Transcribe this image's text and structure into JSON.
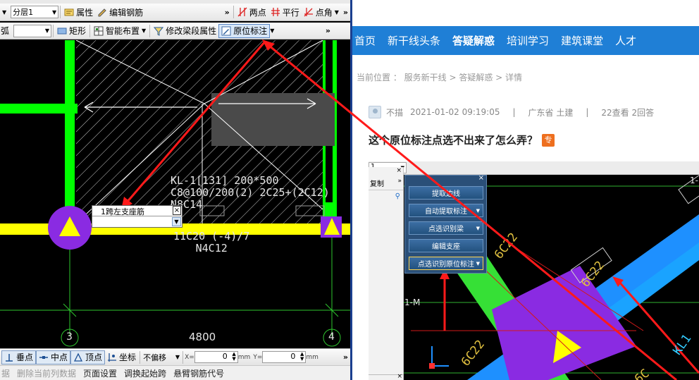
{
  "left_app": {
    "toolbar1": {
      "floor_combo": "分层1",
      "properties_btn": "属性",
      "edit_rebar_btn": "编辑钢筋",
      "two_point_btn": "两点",
      "parallel_btn": "平行",
      "point_angle_btn": "点角"
    },
    "toolbar2": {
      "rect_btn": "矩形",
      "smart_layout_btn": "智能布置",
      "modify_beam_btn": "修改梁段属性",
      "in_situ_mark_btn": "原位标注",
      "left_frag": "弧"
    },
    "drawing": {
      "beam_text1": "KL-1[131] 200*500",
      "beam_text2": "C8@100/200(2) 2C25+(2C12)",
      "beam_text3": "N8C14",
      "beam_text4": "11C20 (-4)/7",
      "beam_text5": "N4C12",
      "dimension": "4800",
      "axis_left": "3",
      "axis_right": "4",
      "popup_title": "1跨左支座筋"
    },
    "snapbar": {
      "perp_btn": "垂点",
      "mid_btn": "中点",
      "vertex_btn": "顶点",
      "coord_btn": "坐标",
      "offset_combo": "不偏移",
      "x_label": "X=",
      "x_value": "0",
      "y_label": "Y=",
      "y_value": "0",
      "unit": "mm"
    },
    "statusbar": {
      "item0": "据",
      "item1": "删除当前列数据",
      "item2": "页面设置",
      "item3": "调换起始跨",
      "item4": "悬臂钢筋代号"
    }
  },
  "web": {
    "nav": [
      "首页",
      "新干线头条",
      "答疑解惑",
      "培训学习",
      "建筑课堂",
      "人才"
    ],
    "nav_active_index": 2,
    "breadcrumb": "当前位置 ： 服务新干线 > 答疑解惑 > 详情",
    "meta": {
      "user": "不描",
      "time": "2021-01-02 09:19:05",
      "sep1": "|",
      "location": "广东省 土建",
      "sep2": "|",
      "views": "22查看 2回答"
    },
    "title": "这个原位标注点选不出来了怎么弄？",
    "badge": "专",
    "screenshot": {
      "combo_value": "1",
      "left_label": "复制",
      "panel_buttons": [
        "提取边线",
        "自动提取标注",
        "点选识别梁",
        "编辑支座",
        "点选识别原位标注"
      ],
      "axis_label": "1-M",
      "axis_label2": "1-",
      "rebar1": "6C22",
      "rebar2": "6C22",
      "rebar3": "6C22",
      "rebar4": "KL1",
      "rebar5": "6C"
    }
  },
  "colors": {
    "nav_bg": "#1f7fd6",
    "badge_bg": "#ee6f1f",
    "beam_yellow": "#ffff00",
    "column_green": "#00ff00",
    "support_purple": "#8a2be2",
    "arrow_red": "#ff1a1a"
  }
}
